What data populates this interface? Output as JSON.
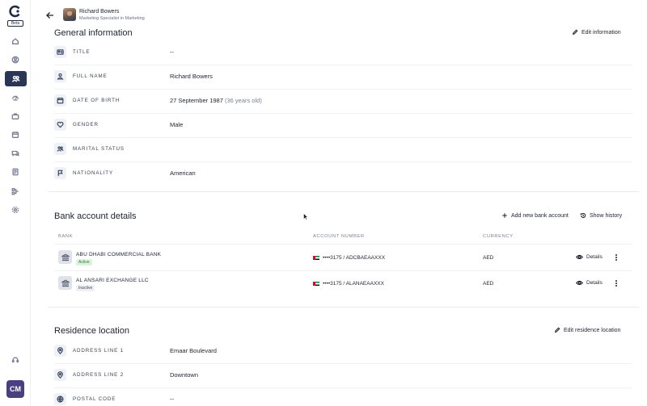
{
  "sidebar": {
    "beta_label": "Beta",
    "icons": [
      "home-icon",
      "user-circle-icon",
      "people-icon",
      "dashboard-icon",
      "briefcase-icon",
      "calendar-icon",
      "chat-icon",
      "document-icon",
      "workflow-icon",
      "settings-icon",
      "support-icon"
    ],
    "active_item": "people-icon",
    "user_initials": "CM"
  },
  "header": {
    "name": "Richard Bowers",
    "role": "Marketing Specialist in Marketing"
  },
  "general": {
    "title": "General information",
    "edit_label": "Edit information",
    "rows": [
      {
        "icon": "id-card-icon",
        "label": "TITLE",
        "value": "--",
        "note": ""
      },
      {
        "icon": "person-icon",
        "label": "FULL NAME",
        "value": "Richard Bowers",
        "note": ""
      },
      {
        "icon": "calendar-icon",
        "label": "DATE OF BIRTH",
        "value": "27 September 1987",
        "note": "(36 years old)"
      },
      {
        "icon": "heart-icon",
        "label": "GENDER",
        "value": "Male",
        "note": ""
      },
      {
        "icon": "people-icon",
        "label": "MARITAL STATUS",
        "value": "",
        "note": ""
      },
      {
        "icon": "flag-icon",
        "label": "NATIONALITY",
        "value": "American",
        "note": ""
      }
    ]
  },
  "bank": {
    "title": "Bank account details",
    "add_label": "Add new bank account",
    "history_label": "Show history",
    "columns": [
      "BANK",
      "ACCOUNT NUMBER",
      "CURRENCY"
    ],
    "rows": [
      {
        "name": "ABU DHABI COMMERCIAL BANK",
        "status": "Active",
        "account": "••••3175 / ADCBAEAAXXX",
        "currency": "AED",
        "details_label": "Details"
      },
      {
        "name": "AL ANSARI EXCHANGE LLC",
        "status": "Inactive",
        "account": "••••3175 / ALANAEAAXXX",
        "currency": "AED",
        "details_label": "Details"
      }
    ]
  },
  "residence": {
    "title": "Residence location",
    "edit_label": "Edit residence location",
    "rows": [
      {
        "icon": "location-pin-icon",
        "label": "ADDRESS LINE 1",
        "value": "Emaar Boulevard"
      },
      {
        "icon": "location-pin-icon",
        "label": "ADDRESS LINE 2",
        "value": "Downtown"
      },
      {
        "icon": "globe-icon",
        "label": "POSTAL CODE",
        "value": "--"
      }
    ]
  },
  "colors": {
    "sidebar_active": "#2b3556",
    "avatar_bg": "#4a3f80",
    "active_badge_bg": "#dcf3dd",
    "active_badge_text": "#2f7a35"
  }
}
